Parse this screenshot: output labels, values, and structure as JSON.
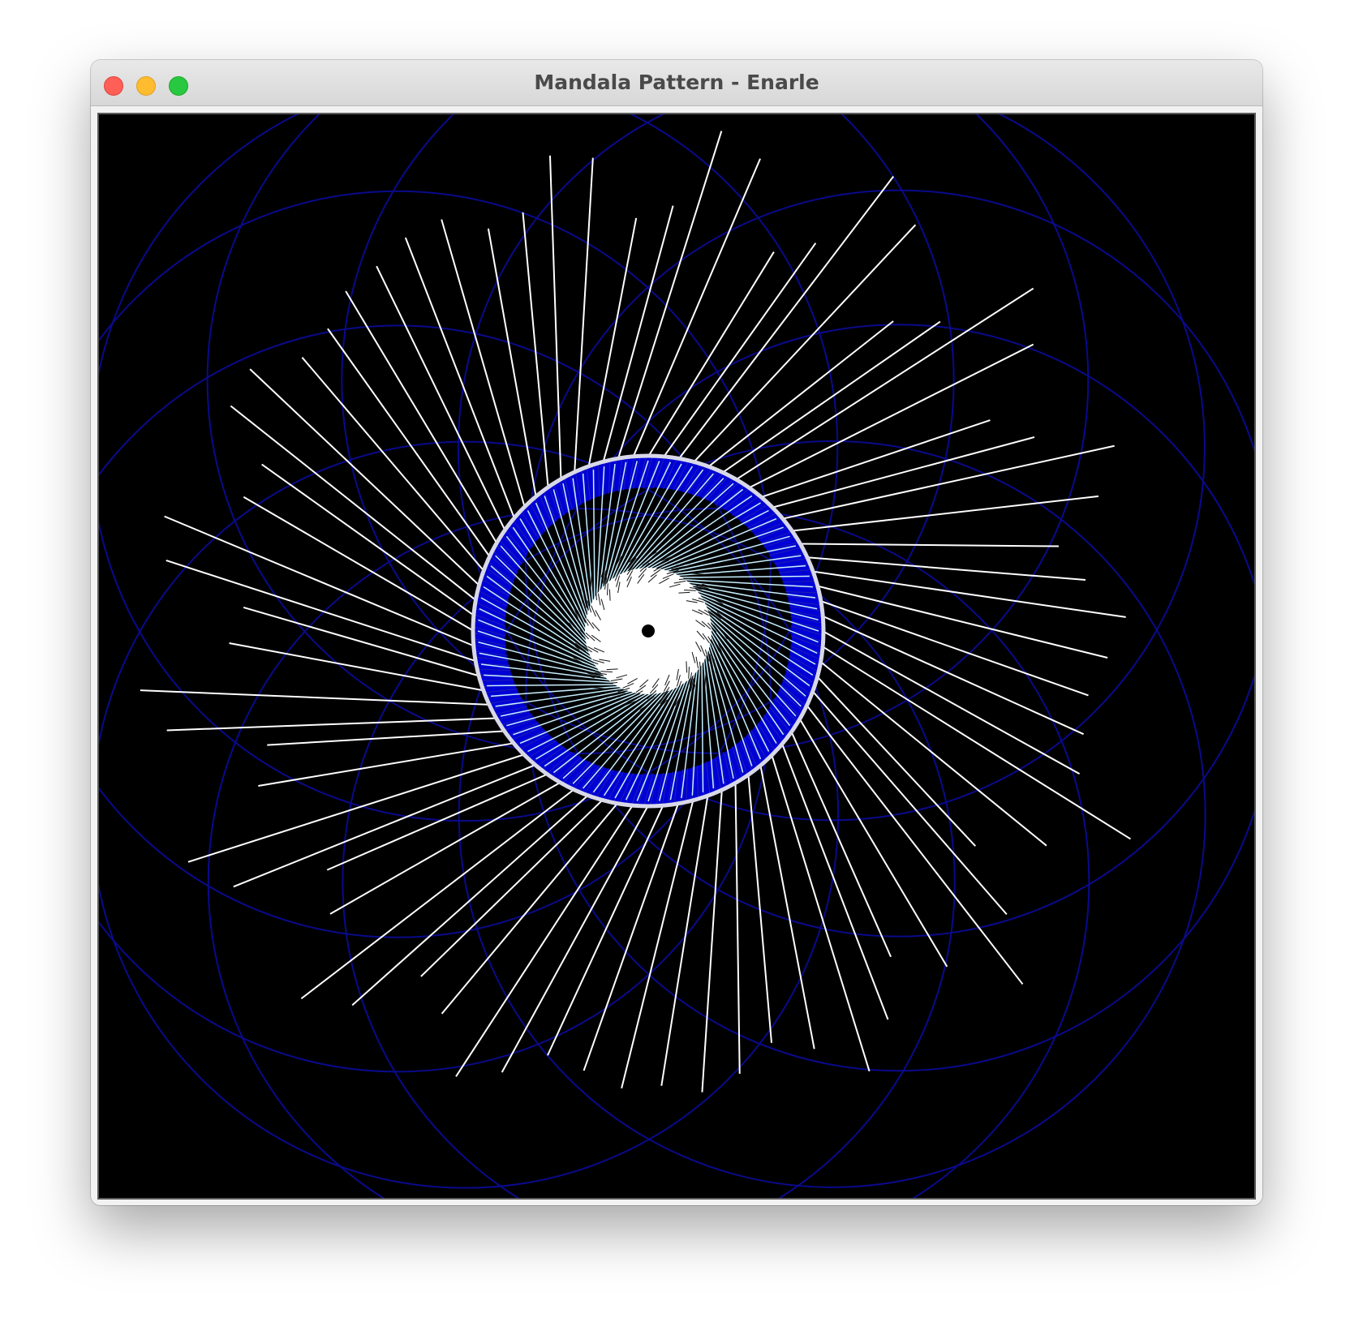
{
  "window": {
    "title": "Mandala Pattern - Enarle"
  },
  "canvas": {
    "background_color": "#000000",
    "petal_circle_color": "#0a0a8c",
    "ring_color": "#0000d6",
    "ray_color": "#ffffff",
    "inner_ray_color": "#c8f0ff",
    "center_dot_color": "#000000"
  },
  "colors": {
    "close": "#fe5f57",
    "minimize": "#febc2e",
    "zoom": "#28c840"
  }
}
